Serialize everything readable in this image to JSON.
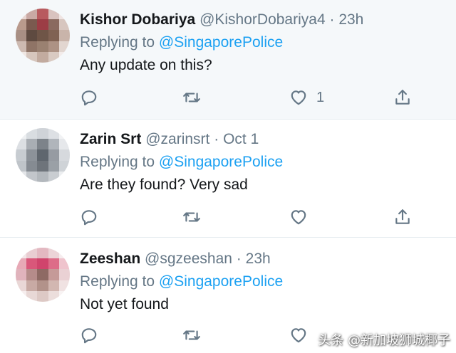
{
  "replies": [
    {
      "name": "Kishor Dobariya",
      "handle": "@KishorDobariya4",
      "separator": "·",
      "time": "23h",
      "replying_label": "Replying to",
      "replying_to": "@SingaporePolice",
      "text": "Any update on this?",
      "like_count": "1",
      "avatar_icon": "user-avatar-blurred"
    },
    {
      "name": "Zarin Srt",
      "handle": "@zarinsrt",
      "separator": "·",
      "time": "Oct 1",
      "replying_label": "Replying to",
      "replying_to": "@SingaporePolice",
      "text": "Are they found? Very sad",
      "like_count": "",
      "avatar_icon": "user-avatar-blurred"
    },
    {
      "name": "Zeeshan",
      "handle": "@sgzeeshan",
      "separator": "·",
      "time": "23h",
      "replying_label": "Replying to",
      "replying_to": "@SingaporePolice",
      "text": "Not yet found",
      "like_count": "",
      "avatar_icon": "user-avatar-blurred"
    }
  ],
  "icons": [
    "reply-icon",
    "retweet-icon",
    "like-icon",
    "share-icon"
  ],
  "colors": {
    "link": "#1da1f2",
    "muted": "#657786",
    "text": "#14171a",
    "highlight_bg": "#f5f8fa"
  },
  "watermark": "头条 @新加坡狮城椰子"
}
